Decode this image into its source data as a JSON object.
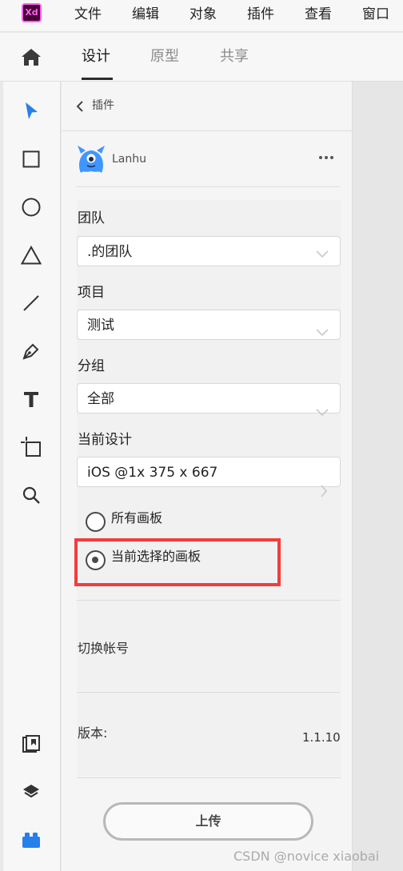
{
  "app": {
    "logo": "Xd"
  },
  "menu": [
    "文件",
    "编辑",
    "对象",
    "插件",
    "查看",
    "窗口"
  ],
  "tabs": [
    {
      "label": "设计",
      "active": true
    },
    {
      "label": "原型",
      "active": false
    },
    {
      "label": "共享",
      "active": false
    }
  ],
  "toolbar": {
    "tools": [
      "select-arrow-icon",
      "rectangle-icon",
      "ellipse-icon",
      "triangle-icon",
      "line-icon",
      "pen-icon",
      "text-icon",
      "artboard-icon",
      "zoom-icon"
    ],
    "bottom": [
      "assets-icon",
      "layers-icon",
      "plugins-icon"
    ],
    "accent": "#2680eb"
  },
  "panel": {
    "back_label": "插件",
    "plugin_name": "Lanhu",
    "team": {
      "label": "团队",
      "value": ".的团队"
    },
    "project": {
      "label": "项目",
      "value": "测试"
    },
    "group": {
      "label": "分组",
      "value": "全部"
    },
    "design": {
      "label": "当前设计",
      "value": "iOS @1x 375 x 667"
    },
    "radios": [
      {
        "label": "所有画板",
        "checked": false
      },
      {
        "label": "当前选择的画板",
        "checked": true
      }
    ],
    "switch_account": "切换帐号",
    "version_label": "版本:",
    "version_value": "1.1.10",
    "upload_label": "上传"
  },
  "watermark": "CSDN @novice xiaobai",
  "colors": {
    "highlight": "#f23d3d",
    "mascot": "#3f96ff",
    "xd_brand": "#ff61f6"
  }
}
